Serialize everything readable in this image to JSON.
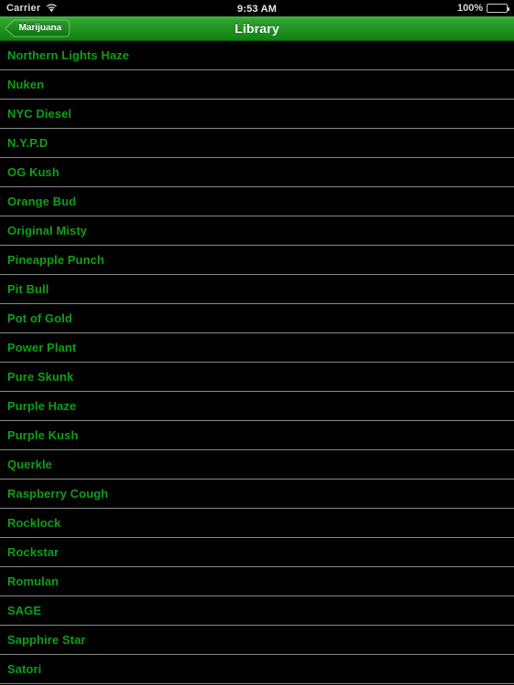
{
  "status_bar": {
    "carrier": "Carrier",
    "wifi_icon": "wifi-icon",
    "time": "9:53 AM",
    "battery_percent": "100%",
    "battery_icon": "battery-full-icon"
  },
  "nav_bar": {
    "back_label": "Marijuana",
    "back_icon": "chevron-left-icon",
    "title": "Library",
    "gradient_top": "#45b245",
    "gradient_bottom": "#0f7d14"
  },
  "theme": {
    "background": "#000000",
    "row_text_color": "#0f9f17",
    "separator_color": "#8a8a8a",
    "title_color": "#ffffff"
  },
  "list": {
    "items": [
      {
        "label": "Northern Lights Haze"
      },
      {
        "label": "Nuken"
      },
      {
        "label": "NYC Diesel"
      },
      {
        "label": "N.Y.P.D"
      },
      {
        "label": "OG Kush"
      },
      {
        "label": "Orange Bud"
      },
      {
        "label": "Original Misty"
      },
      {
        "label": "Pineapple Punch"
      },
      {
        "label": "Pit Bull"
      },
      {
        "label": "Pot of Gold"
      },
      {
        "label": "Power Plant"
      },
      {
        "label": "Pure Skunk"
      },
      {
        "label": "Purple Haze"
      },
      {
        "label": "Purple Kush"
      },
      {
        "label": "Querkle"
      },
      {
        "label": "Raspberry Cough"
      },
      {
        "label": "Rocklock"
      },
      {
        "label": "Rockstar"
      },
      {
        "label": "Romulan"
      },
      {
        "label": "SAGE"
      },
      {
        "label": "Sapphire Star"
      },
      {
        "label": "Satori"
      }
    ]
  }
}
